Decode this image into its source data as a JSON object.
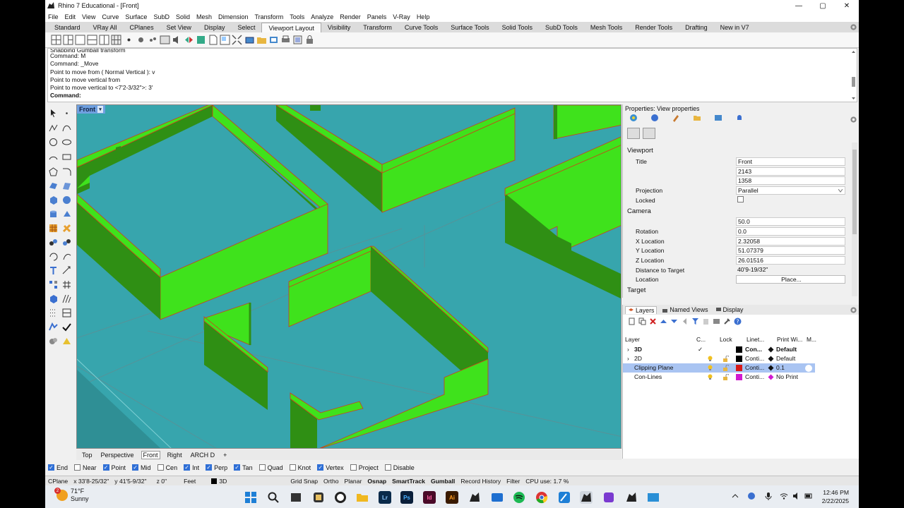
{
  "window": {
    "title": "Rhino 7 Educational - [Front]",
    "controls": {
      "minimize": "—",
      "maximize": "▢",
      "close": "✕"
    }
  },
  "menu": [
    "File",
    "Edit",
    "View",
    "Curve",
    "Surface",
    "SubD",
    "Solid",
    "Mesh",
    "Dimension",
    "Transform",
    "Tools",
    "Analyze",
    "Render",
    "Panels",
    "V-Ray",
    "Help"
  ],
  "toolbar_tabs": [
    "Standard",
    "VRay All",
    "CPlanes",
    "Set View",
    "Display",
    "Select",
    "Viewport Layout",
    "Visibility",
    "Transform",
    "Curve Tools",
    "Surface Tools",
    "Solid Tools",
    "SubD Tools",
    "Mesh Tools",
    "Render Tools",
    "Drafting",
    "New in V7"
  ],
  "toolbar_active_tab": "Viewport Layout",
  "command_history": {
    "partial_line": "Snapping Gumball transform",
    "lines": [
      "Command: M",
      "Command: _Move",
      "Point to move from ( Normal  Vertical ): v",
      "Point to move vertical from",
      "Point to move vertical to <7'2-3/32\">: 3'"
    ],
    "prompt": "Command:"
  },
  "viewport": {
    "label": "Front",
    "dropdown_icon": "▾",
    "colors": {
      "background": "#37a5ad",
      "wall_top": "#3fe21c",
      "wall_side": "#2f8f14",
      "wall_edge": "#d23a1a"
    }
  },
  "viewport_tabs": [
    "Top",
    "Perspective",
    "Front",
    "Right",
    "ARCH D",
    "+"
  ],
  "viewport_active_tab": "Front",
  "osnaps": [
    {
      "label": "End",
      "checked": true
    },
    {
      "label": "Near",
      "checked": false
    },
    {
      "label": "Point",
      "checked": true
    },
    {
      "label": "Mid",
      "checked": true
    },
    {
      "label": "Cen",
      "checked": false
    },
    {
      "label": "Int",
      "checked": true
    },
    {
      "label": "Perp",
      "checked": true
    },
    {
      "label": "Tan",
      "checked": true
    },
    {
      "label": "Quad",
      "checked": false
    },
    {
      "label": "Knot",
      "checked": false
    },
    {
      "label": "Vertex",
      "checked": true
    },
    {
      "label": "Project",
      "checked": false
    },
    {
      "label": "Disable",
      "checked": false
    }
  ],
  "statusbar": {
    "cplane": "CPlane",
    "x": "x 33'8-25/32\"",
    "y": "y 41'5-9/32\"",
    "z": "z 0\"",
    "units": "Feet",
    "layer": "3D",
    "grid_snap": "Grid Snap",
    "ortho": "Ortho",
    "planar": "Planar",
    "osnap": "Osnap",
    "smarttrack": "SmartTrack",
    "gumball": "Gumball",
    "record_history": "Record History",
    "filter": "Filter",
    "cpu": "CPU use: 1.7 %"
  },
  "properties": {
    "header": "Properties: View properties",
    "viewport_section": "Viewport",
    "camera_section": "Camera",
    "target_section": "Target",
    "rows": {
      "title_label": "Title",
      "title_value": "Front",
      "width_value": "2143",
      "height_value": "1358",
      "projection_label": "Projection",
      "projection_value": "Parallel",
      "locked_label": "Locked",
      "locked_checked": false,
      "lens_value": "50.0",
      "rotation_label": "Rotation",
      "rotation_value": "0.0",
      "xloc_label": "X Location",
      "xloc_value": "2.32058",
      "yloc_label": "Y Location",
      "yloc_value": "51.07379",
      "zloc_label": "Z Location",
      "zloc_value": "26.01516",
      "dist_label": "Distance to Target",
      "dist_value": "40'9-19/32\"",
      "location_label": "Location",
      "location_button": "Place..."
    }
  },
  "layers_panel": {
    "tabs": [
      "Layers",
      "Named Views",
      "Display"
    ],
    "active_tab": "Layers",
    "columns": [
      "Layer",
      "C...",
      "Lock",
      "Linet...",
      "Print Wi...",
      "M..."
    ],
    "rows": [
      {
        "name": "3D",
        "current": "✓",
        "linetype": "Con...",
        "print_width": "Default",
        "color": "#000000",
        "bold": true,
        "expand": "›"
      },
      {
        "name": "2D",
        "current": "",
        "linetype": "Conti...",
        "print_width": "Default",
        "color": "#000000",
        "bold": false,
        "expand": "›"
      },
      {
        "name": "Clipping Plane",
        "current": "",
        "linetype": "Conti...",
        "print_width": "0.1",
        "color": "#d61a1a",
        "bold": false,
        "expand": ""
      },
      {
        "name": "Con-Lines",
        "current": "",
        "linetype": "Conti...",
        "print_width": "No Print",
        "color": "#d01ad0",
        "bold": false,
        "expand": ""
      }
    ]
  },
  "taskbar": {
    "weather_temp": "71°F",
    "weather_desc": "Sunny",
    "weather_badge": "2",
    "apps": [
      "Lr",
      "Ps",
      "Id",
      "Ai"
    ],
    "time": "12:46 PM",
    "date": "2/22/2025"
  }
}
